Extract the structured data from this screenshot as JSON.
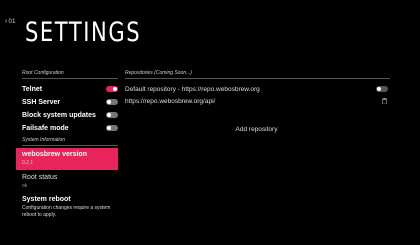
{
  "header": {
    "back_label": "01",
    "title": "SETTINGS"
  },
  "root_config": {
    "section_label": "Root Configuration",
    "items": [
      {
        "label": "Telnet",
        "state": "on"
      },
      {
        "label": "SSH Server",
        "state": "off"
      },
      {
        "label": "Block system updates",
        "state": "off"
      },
      {
        "label": "Failsafe mode",
        "state": "off"
      }
    ]
  },
  "system_info": {
    "section_label": "System Information",
    "items": [
      {
        "label": "webosbrew version",
        "value": "0.2.1"
      },
      {
        "label": "Root status",
        "value": "ok"
      }
    ]
  },
  "reboot": {
    "label": "System reboot",
    "description": "Configuration changes require a system reboot to apply."
  },
  "repositories": {
    "section_label": "Repositories (Coming Soon...)",
    "items": [
      {
        "label": "Default repository - https://repo.webosbrew.org",
        "control": "toggle",
        "state": "off"
      },
      {
        "label": "https://repo.webosbrew.org/api/",
        "control": "delete"
      }
    ],
    "add_label": "Add repository"
  },
  "colors": {
    "accent": "#e8245a",
    "background": "#000000"
  }
}
